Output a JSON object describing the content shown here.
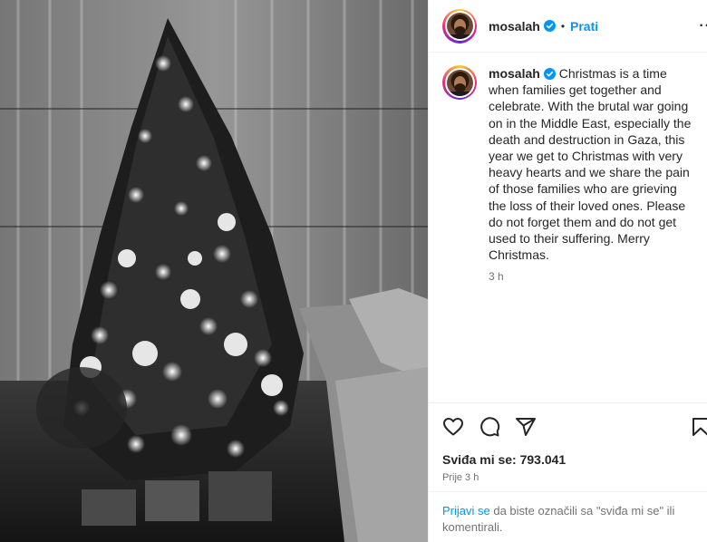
{
  "post": {
    "username": "mosalah",
    "follow_label": "Prati",
    "dot": "•",
    "more": "··",
    "caption": "Christmas is a time when families get together and celebrate. With the brutal war going on in the Middle East, especially the death and destruction in Gaza, this year we get to Christmas with very heavy hearts and we share the pain of those families who are grieving the loss of their loved ones. Please do not forget them and do not get used to their suffering. Merry Christmas.",
    "caption_time": "3 h",
    "likes": "Sviđa mi se: 793.041",
    "posted_ago": "Prije 3 h"
  },
  "login": {
    "link": "Prijavi se",
    "text": " da biste označili sa \"sviđa mi se\" ili komentirali."
  },
  "icons": {
    "like": "heart-icon",
    "comment": "comment-icon",
    "share": "share-icon",
    "save": "bookmark-icon",
    "verified": "verified-badge-icon"
  },
  "colors": {
    "accent": "#0095f6",
    "text": "#262626",
    "secondary": "#737373",
    "verified": "#0095f6"
  }
}
